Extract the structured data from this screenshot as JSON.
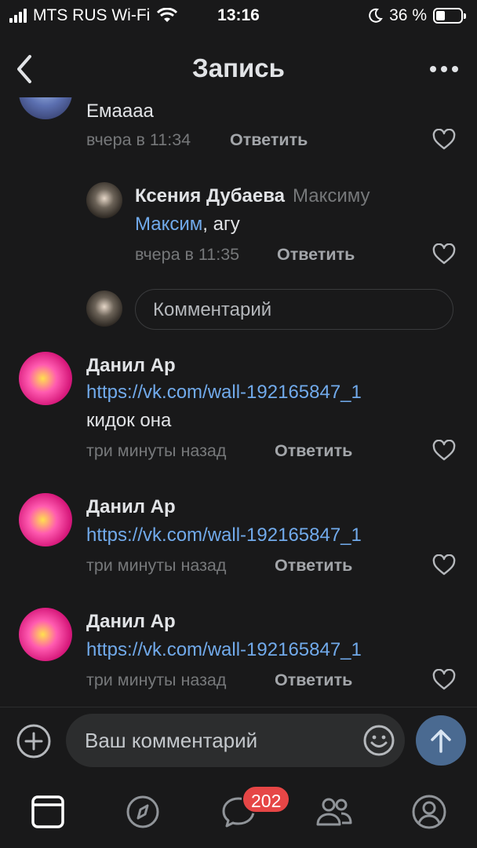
{
  "status_bar": {
    "carrier": "MTS RUS Wi-Fi",
    "time": "13:16",
    "battery_percent": "36 %",
    "battery_level": 0.36
  },
  "nav": {
    "title": "Запись",
    "back_icon": "chevron-left-icon",
    "more_icon": "more-dots-icon"
  },
  "comments": [
    {
      "text": "Емаааа",
      "time": "вчера в 11:34",
      "reply_label": "Ответить"
    },
    {
      "author": "Ксения Дубаева",
      "addressee": "Максиму",
      "mention": "Максим",
      "text": ", агу",
      "time": "вчера в 11:35",
      "reply_label": "Ответить"
    },
    {
      "author": "Данил Ар",
      "link": "https://vk.com/wall-192165847_1",
      "text": "кидок она",
      "time": "три минуты назад",
      "reply_label": "Ответить"
    },
    {
      "author": "Данил Ар",
      "link": "https://vk.com/wall-192165847_1",
      "time": "три минуты назад",
      "reply_label": "Ответить"
    },
    {
      "author": "Данил Ар",
      "link": "https://vk.com/wall-192165847_1",
      "time": "три минуты назад",
      "reply_label": "Ответить"
    }
  ],
  "reply_box": {
    "placeholder": "Комментарий"
  },
  "input_bar": {
    "placeholder": "Ваш комментарий"
  },
  "tab_bar": {
    "items": [
      "feed-icon",
      "explore-compass-icon",
      "messages-icon",
      "friends-icon",
      "profile-icon"
    ],
    "messages_badge": "202"
  },
  "colors": {
    "background": "#19191a",
    "link": "#71aaeb",
    "secondary_text": "#76787a",
    "badge": "#e64646",
    "send_button": "#4a6a91"
  }
}
